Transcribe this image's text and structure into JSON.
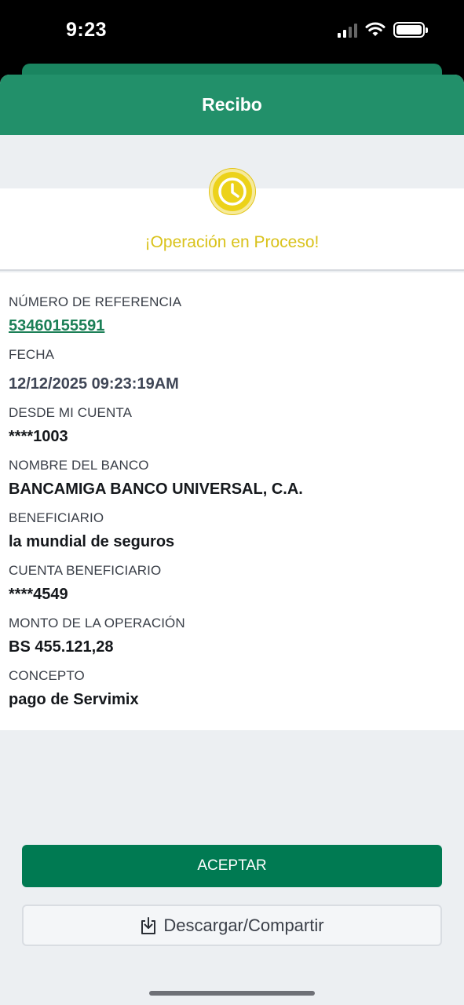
{
  "status_bar": {
    "time": "9:23"
  },
  "header": {
    "title": "Recibo"
  },
  "status": {
    "message": "¡Operación en Proceso!",
    "color": "#ecd21a"
  },
  "details": [
    {
      "label": "NÚMERO DE REFERENCIA",
      "value": "53460155591"
    },
    {
      "label": "FECHA",
      "value": "12/12/2025 09:23:19AM"
    },
    {
      "label": "DESDE MI CUENTA",
      "value": "****1003"
    },
    {
      "label": "NOMBRE DEL BANCO",
      "value": "BANCAMIGA BANCO UNIVERSAL, C.A."
    },
    {
      "label": "BENEFICIARIO",
      "value": "la mundial de seguros"
    },
    {
      "label": "CUENTA BENEFICIARIO",
      "value": "****4549"
    },
    {
      "label": "MONTO DE LA OPERACIÓN",
      "value": "BS 455.121,28"
    },
    {
      "label": "CONCEPTO",
      "value": "pago de Servimix"
    }
  ],
  "actions": {
    "accept_label": "ACEPTAR",
    "share_label": "Descargar/Compartir",
    "share_icon": "download-share-icon"
  },
  "colors": {
    "brand_green": "#007a52",
    "header_green": "#22906a"
  }
}
